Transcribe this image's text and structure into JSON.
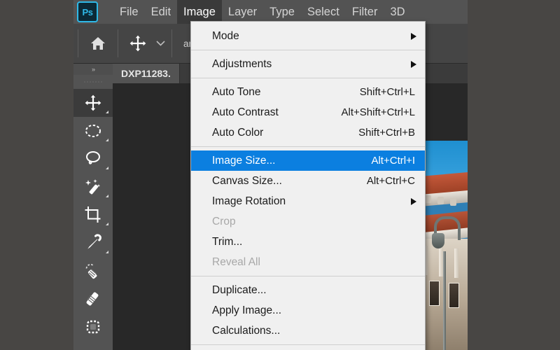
{
  "app": {
    "name": "Adobe Photoshop",
    "logo_text": "Ps"
  },
  "menubar": {
    "items": [
      {
        "label": "File",
        "open": false
      },
      {
        "label": "Edit",
        "open": false
      },
      {
        "label": "Image",
        "open": true
      },
      {
        "label": "Layer",
        "open": false
      },
      {
        "label": "Type",
        "open": false
      },
      {
        "label": "Select",
        "open": false
      },
      {
        "label": "Filter",
        "open": false
      },
      {
        "label": "3D",
        "open": false
      }
    ]
  },
  "options_bar": {
    "home_icon": "home-icon",
    "tool_icon": "move-tool-icon",
    "chevron_icon": "chevron-down-icon",
    "clipped_label": "ansform C"
  },
  "tab_bar": {
    "tabs": [
      {
        "label": "DXP11283."
      }
    ]
  },
  "toolbar": {
    "collapse_label": "»",
    "tools": [
      {
        "name": "move-tool",
        "label": "Move Tool",
        "active": true,
        "has_flyout": true
      },
      {
        "name": "elliptical-marquee-tool",
        "label": "Elliptical Marquee Tool",
        "active": false,
        "has_flyout": true
      },
      {
        "name": "lasso-tool",
        "label": "Lasso Tool",
        "active": false,
        "has_flyout": true
      },
      {
        "name": "magic-wand-tool",
        "label": "Object Selection Tool",
        "active": false,
        "has_flyout": true
      },
      {
        "name": "crop-tool",
        "label": "Crop Tool",
        "active": false,
        "has_flyout": true
      },
      {
        "name": "eyedropper-tool",
        "label": "Eyedropper Tool",
        "active": false,
        "has_flyout": true
      },
      {
        "name": "spot-healing-brush-tool",
        "label": "Spot Healing Brush Tool",
        "active": false,
        "has_flyout": false
      },
      {
        "name": "brush-tool",
        "label": "Brush Tool",
        "active": false,
        "has_flyout": false
      },
      {
        "name": "patch-tool",
        "label": "Patch Tool",
        "active": false,
        "has_flyout": false
      }
    ]
  },
  "image_menu": {
    "title": "Image",
    "groups": [
      {
        "items": [
          {
            "label": "Mode",
            "accel": "",
            "submenu": true,
            "disabled": false,
            "selected": false
          }
        ]
      },
      {
        "items": [
          {
            "label": "Adjustments",
            "accel": "",
            "submenu": true,
            "disabled": false,
            "selected": false
          }
        ]
      },
      {
        "items": [
          {
            "label": "Auto Tone",
            "accel": "Shift+Ctrl+L",
            "submenu": false,
            "disabled": false,
            "selected": false
          },
          {
            "label": "Auto Contrast",
            "accel": "Alt+Shift+Ctrl+L",
            "submenu": false,
            "disabled": false,
            "selected": false
          },
          {
            "label": "Auto Color",
            "accel": "Shift+Ctrl+B",
            "submenu": false,
            "disabled": false,
            "selected": false
          }
        ]
      },
      {
        "items": [
          {
            "label": "Image Size...",
            "accel": "Alt+Ctrl+I",
            "submenu": false,
            "disabled": false,
            "selected": true
          },
          {
            "label": "Canvas Size...",
            "accel": "Alt+Ctrl+C",
            "submenu": false,
            "disabled": false,
            "selected": false
          },
          {
            "label": "Image Rotation",
            "accel": "",
            "submenu": true,
            "disabled": false,
            "selected": false
          },
          {
            "label": "Crop",
            "accel": "",
            "submenu": false,
            "disabled": true,
            "selected": false
          },
          {
            "label": "Trim...",
            "accel": "",
            "submenu": false,
            "disabled": false,
            "selected": false
          },
          {
            "label": "Reveal All",
            "accel": "",
            "submenu": false,
            "disabled": true,
            "selected": false
          }
        ]
      },
      {
        "items": [
          {
            "label": "Duplicate...",
            "accel": "",
            "submenu": false,
            "disabled": false,
            "selected": false
          },
          {
            "label": "Apply Image...",
            "accel": "",
            "submenu": false,
            "disabled": false,
            "selected": false
          },
          {
            "label": "Calculations...",
            "accel": "",
            "submenu": false,
            "disabled": false,
            "selected": false
          }
        ]
      }
    ]
  },
  "colors": {
    "menu_highlight": "#0b7fe0",
    "menu_background": "#f0f0f0",
    "chrome_background": "#535353",
    "options_bar": "#454545",
    "canvas_background": "#282828",
    "frame_background": "#484644",
    "logo_accent": "#2fb9e8"
  }
}
